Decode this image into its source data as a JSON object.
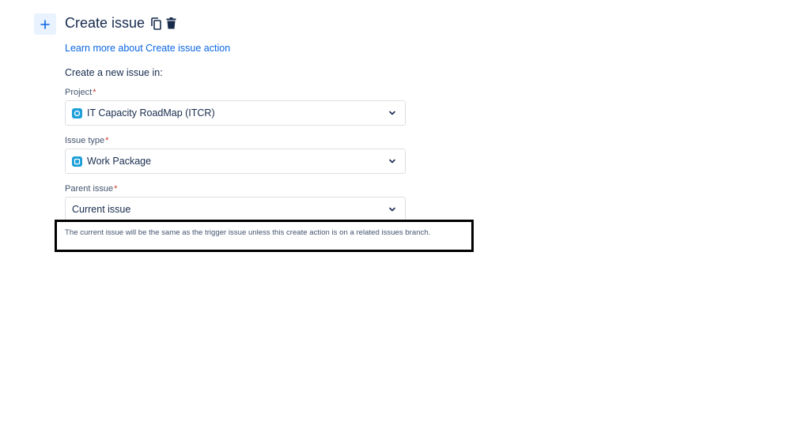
{
  "header": {
    "add_icon": "plus-icon",
    "title": "Create issue",
    "copy_icon": "copy-icon",
    "delete_icon": "trash-icon"
  },
  "learn_more_link": "Learn more about Create issue action",
  "intro_text": "Create a new issue in:",
  "fields": {
    "project": {
      "label": "Project",
      "required_marker": "*",
      "value": "IT Capacity RoadMap (ITCR)",
      "icon": "project-icon"
    },
    "issue_type": {
      "label": "Issue type",
      "required_marker": "*",
      "value": "Work Package",
      "icon": "issue-type-icon"
    },
    "parent_issue": {
      "label": "Parent issue",
      "required_marker": "*",
      "value": "Current issue"
    }
  },
  "helper_text": "The current issue will be the same as the trigger issue unless this create action is on a related issues branch.",
  "colors": {
    "accent": "#0c66e4",
    "required": "#c9372c",
    "add_button_bg": "#e9f2ff",
    "icon_cyan": "#1d9fd8"
  }
}
